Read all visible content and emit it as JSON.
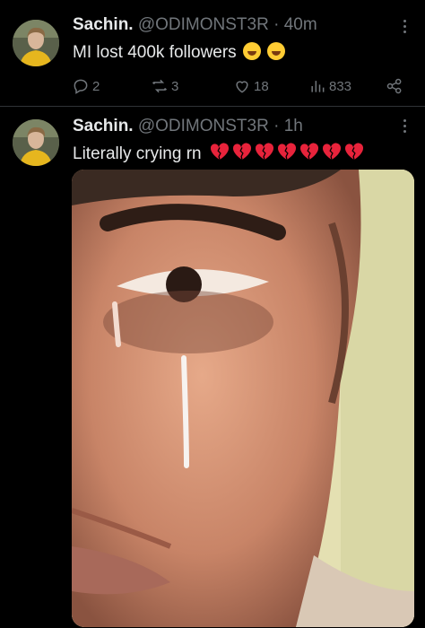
{
  "tweets": [
    {
      "name": "Sachin.",
      "handle": "@ODIMONST3R",
      "separator": "·",
      "time": "40m",
      "text": "MI lost 400k followers",
      "emojis": [
        "rolling-on-floor-laughing",
        "rolling-on-floor-laughing"
      ],
      "stats": {
        "replies": "2",
        "retweets": "3",
        "likes": "18",
        "views": "833"
      }
    },
    {
      "name": "Sachin.",
      "handle": "@ODIMONST3R",
      "separator": "·",
      "time": "1h",
      "text": "Literally crying rn",
      "emojis": [
        "broken-heart",
        "broken-heart",
        "broken-heart",
        "broken-heart",
        "broken-heart",
        "broken-heart",
        "broken-heart"
      ],
      "media": {
        "description": "Photo of a man's face close up with tears running down his cheek"
      }
    }
  ],
  "colors": {
    "background": "#000000",
    "text": "#e7e9ea",
    "secondary": "#71767b",
    "divider": "#2f3336",
    "heart": "#e8233b"
  }
}
